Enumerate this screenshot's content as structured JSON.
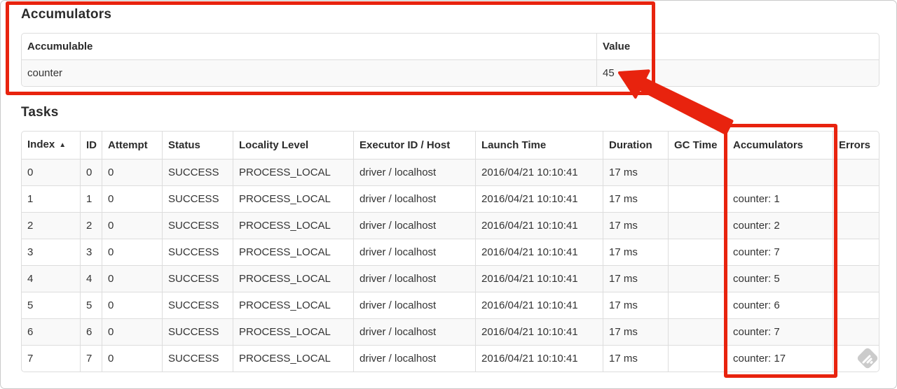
{
  "accumulators_section": {
    "title": "Accumulators",
    "table": {
      "columns": [
        {
          "key": "accumulable",
          "label": "Accumulable"
        },
        {
          "key": "value",
          "label": "Value"
        }
      ],
      "rows": [
        {
          "accumulable": "counter",
          "value": "45"
        }
      ]
    }
  },
  "tasks_section": {
    "title": "Tasks",
    "table": {
      "sort_icon": "▲",
      "sorted_column": "index",
      "columns": [
        {
          "key": "index",
          "label": "Index"
        },
        {
          "key": "id",
          "label": "ID"
        },
        {
          "key": "attempt",
          "label": "Attempt"
        },
        {
          "key": "status",
          "label": "Status"
        },
        {
          "key": "locality",
          "label": "Locality Level"
        },
        {
          "key": "executor",
          "label": "Executor ID / Host"
        },
        {
          "key": "launch",
          "label": "Launch Time"
        },
        {
          "key": "duration",
          "label": "Duration"
        },
        {
          "key": "gc_time",
          "label": "GC Time"
        },
        {
          "key": "accumulators",
          "label": "Accumulators"
        },
        {
          "key": "errors",
          "label": "Errors"
        }
      ],
      "rows": [
        {
          "index": "0",
          "id": "0",
          "attempt": "0",
          "status": "SUCCESS",
          "locality": "PROCESS_LOCAL",
          "executor": "driver / localhost",
          "launch": "2016/04/21 10:10:41",
          "duration": "17 ms",
          "gc_time": "",
          "accumulators": "",
          "errors": ""
        },
        {
          "index": "1",
          "id": "1",
          "attempt": "0",
          "status": "SUCCESS",
          "locality": "PROCESS_LOCAL",
          "executor": "driver / localhost",
          "launch": "2016/04/21 10:10:41",
          "duration": "17 ms",
          "gc_time": "",
          "accumulators": "counter: 1",
          "errors": ""
        },
        {
          "index": "2",
          "id": "2",
          "attempt": "0",
          "status": "SUCCESS",
          "locality": "PROCESS_LOCAL",
          "executor": "driver / localhost",
          "launch": "2016/04/21 10:10:41",
          "duration": "17 ms",
          "gc_time": "",
          "accumulators": "counter: 2",
          "errors": ""
        },
        {
          "index": "3",
          "id": "3",
          "attempt": "0",
          "status": "SUCCESS",
          "locality": "PROCESS_LOCAL",
          "executor": "driver / localhost",
          "launch": "2016/04/21 10:10:41",
          "duration": "17 ms",
          "gc_time": "",
          "accumulators": "counter: 7",
          "errors": ""
        },
        {
          "index": "4",
          "id": "4",
          "attempt": "0",
          "status": "SUCCESS",
          "locality": "PROCESS_LOCAL",
          "executor": "driver / localhost",
          "launch": "2016/04/21 10:10:41",
          "duration": "17 ms",
          "gc_time": "",
          "accumulators": "counter: 5",
          "errors": ""
        },
        {
          "index": "5",
          "id": "5",
          "attempt": "0",
          "status": "SUCCESS",
          "locality": "PROCESS_LOCAL",
          "executor": "driver / localhost",
          "launch": "2016/04/21 10:10:41",
          "duration": "17 ms",
          "gc_time": "",
          "accumulators": "counter: 6",
          "errors": ""
        },
        {
          "index": "6",
          "id": "6",
          "attempt": "0",
          "status": "SUCCESS",
          "locality": "PROCESS_LOCAL",
          "executor": "driver / localhost",
          "launch": "2016/04/21 10:10:41",
          "duration": "17 ms",
          "gc_time": "",
          "accumulators": "counter: 7",
          "errors": ""
        },
        {
          "index": "7",
          "id": "7",
          "attempt": "0",
          "status": "SUCCESS",
          "locality": "PROCESS_LOCAL",
          "executor": "driver / localhost",
          "launch": "2016/04/21 10:10:41",
          "duration": "17 ms",
          "gc_time": "",
          "accumulators": "counter: 17",
          "errors": ""
        }
      ]
    }
  },
  "annotations": {
    "red_color": "#e8230e",
    "boxes": [
      "accumulators-summary-box",
      "accumulators-column-box"
    ],
    "arrow_points_to": "45"
  },
  "colors": {
    "text": "#333333",
    "table_border": "#dddddd",
    "row_stripe": "#f9f9f9",
    "annotation_red": "#e8230e",
    "watermark_gray": "#c9c9c9"
  },
  "watermark": {
    "name": "screenshot-tool-logo"
  }
}
